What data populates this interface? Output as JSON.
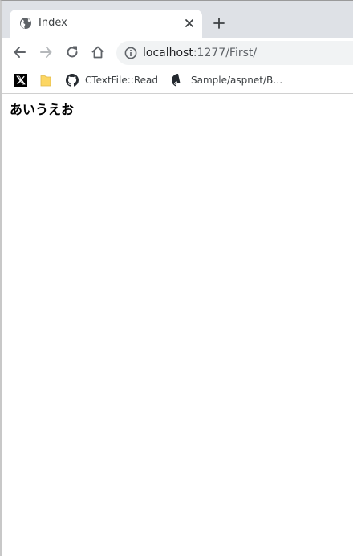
{
  "browser": {
    "tab": {
      "title": "Index",
      "icon": "globe-icon"
    },
    "address": {
      "host": "localhost",
      "path": ":1277/First/"
    },
    "bookmarks": [
      {
        "icon": "x-logo-icon",
        "label": ""
      },
      {
        "icon": "folder-icon",
        "label": ""
      },
      {
        "icon": "github-icon",
        "label": "CTextFile::Read"
      },
      {
        "icon": "github-icon",
        "label": "Sample/aspnet/B…"
      }
    ]
  },
  "page": {
    "heading": "あいうえお"
  },
  "colors": {
    "tabstrip": "#dee1e6",
    "omnibox": "#f1f3f4",
    "folder": "#fcd663"
  }
}
